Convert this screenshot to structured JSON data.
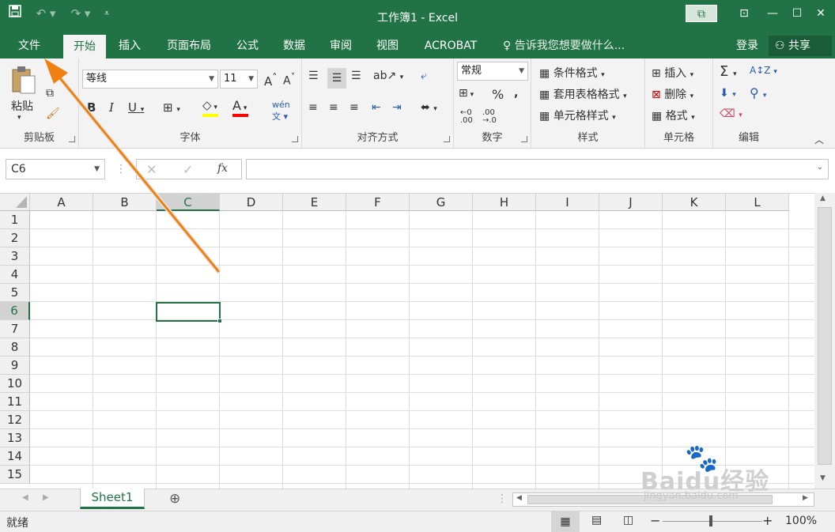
{
  "window": {
    "title": "工作簿1 - Excel"
  },
  "tabs": [
    "文件",
    "开始",
    "插入",
    "页面布局",
    "公式",
    "数据",
    "审阅",
    "视图",
    "ACROBAT"
  ],
  "tell_me": "告诉我您想要做什么...",
  "login": "登录",
  "share": "共享",
  "clipboard": {
    "paste": "粘贴",
    "label": "剪贴板"
  },
  "font": {
    "name": "等线",
    "size": "11",
    "label": "字体",
    "color_accent": "#ff0000",
    "fill_accent": "#ffff00"
  },
  "alignment": {
    "label": "对齐方式"
  },
  "number": {
    "format": "常规",
    "label": "数字"
  },
  "styles": {
    "cond_format": "条件格式",
    "table_format": "套用表格格式",
    "cell_styles": "单元格样式",
    "label": "样式"
  },
  "cells": {
    "insert": "插入",
    "delete": "删除",
    "format": "格式",
    "label": "单元格"
  },
  "editing": {
    "label": "编辑"
  },
  "formula_bar": {
    "name_box": "C6",
    "formula": ""
  },
  "columns": [
    "A",
    "B",
    "C",
    "D",
    "E",
    "F",
    "G",
    "H",
    "I",
    "J",
    "K",
    "L"
  ],
  "rows": [
    "1",
    "2",
    "3",
    "4",
    "5",
    "6",
    "7",
    "8",
    "9",
    "10",
    "11",
    "12",
    "13",
    "14",
    "15"
  ],
  "selection": {
    "column": "C",
    "row": "6"
  },
  "sheets": [
    "Sheet1"
  ],
  "status": {
    "text": "就绪",
    "zoom": "100%"
  },
  "watermark": {
    "brand": "Baidu经验",
    "url": "jingyan.baidu.com"
  },
  "colors": {
    "excel_green": "#217346",
    "arrow": "#f08010"
  }
}
